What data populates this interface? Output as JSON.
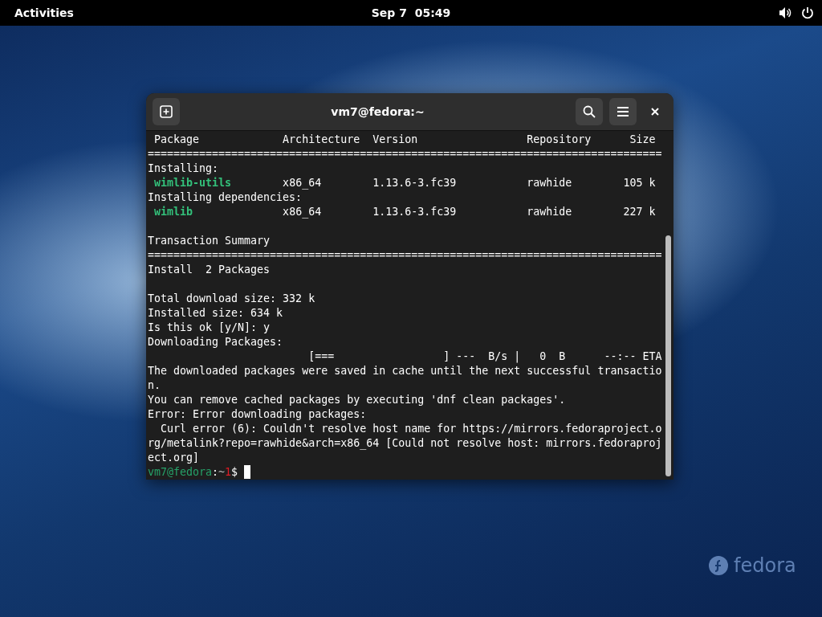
{
  "top_bar": {
    "activities": "Activities",
    "clock": "Sep 7  05:49"
  },
  "terminal": {
    "title": "vm7@fedora:~",
    "lines": [
      {
        "spans": [
          {
            "kind": "plain",
            "text": " Package             Architecture  Version                 Repository      Size"
          }
        ]
      },
      {
        "spans": [
          {
            "kind": "plain",
            "text": "================================================================================"
          }
        ]
      },
      {
        "spans": [
          {
            "kind": "plain",
            "text": "Installing:"
          }
        ]
      },
      {
        "spans": [
          {
            "kind": "package",
            "text": " wimlib-utils"
          },
          {
            "kind": "plain",
            "text": "        x86_64        1.13.6-3.fc39           rawhide        105 k"
          }
        ]
      },
      {
        "spans": [
          {
            "kind": "plain",
            "text": "Installing dependencies:"
          }
        ]
      },
      {
        "spans": [
          {
            "kind": "package",
            "text": " wimlib"
          },
          {
            "kind": "plain",
            "text": "              x86_64        1.13.6-3.fc39           rawhide        227 k"
          }
        ]
      },
      {
        "kind": "blank"
      },
      {
        "spans": [
          {
            "kind": "plain",
            "text": "Transaction Summary"
          }
        ]
      },
      {
        "spans": [
          {
            "kind": "plain",
            "text": "================================================================================"
          }
        ]
      },
      {
        "spans": [
          {
            "kind": "plain",
            "text": "Install  2 Packages"
          }
        ]
      },
      {
        "kind": "blank"
      },
      {
        "spans": [
          {
            "kind": "plain",
            "text": "Total download size: 332 k"
          }
        ]
      },
      {
        "spans": [
          {
            "kind": "plain",
            "text": "Installed size: 634 k"
          }
        ]
      },
      {
        "spans": [
          {
            "kind": "plain",
            "text": "Is this ok [y/N]: y"
          }
        ]
      },
      {
        "spans": [
          {
            "kind": "plain",
            "text": "Downloading Packages:"
          }
        ]
      },
      {
        "spans": [
          {
            "kind": "plain",
            "text": "                         [===                 ] ---  B/s |   0  B      --:-- ETA"
          }
        ]
      },
      {
        "spans": [
          {
            "kind": "plain",
            "text": "The downloaded packages were saved in cache until the next successful transactio"
          }
        ]
      },
      {
        "spans": [
          {
            "kind": "plain",
            "text": "n."
          }
        ]
      },
      {
        "spans": [
          {
            "kind": "plain",
            "text": "You can remove cached packages by executing 'dnf clean packages'."
          }
        ]
      },
      {
        "spans": [
          {
            "kind": "plain",
            "text": "Error: Error downloading packages:"
          }
        ]
      },
      {
        "spans": [
          {
            "kind": "plain",
            "text": "  Curl error (6): Couldn't resolve host name for https://mirrors.fedoraproject.o"
          }
        ]
      },
      {
        "spans": [
          {
            "kind": "plain",
            "text": "rg/metalink?repo=rawhide&arch=x86_64 [Could not resolve host: mirrors.fedoraproj"
          }
        ]
      },
      {
        "spans": [
          {
            "kind": "plain",
            "text": "ect.org]"
          }
        ]
      },
      {
        "spans": [
          {
            "kind": "user",
            "text": "vm7@fedora"
          },
          {
            "kind": "plain",
            "text": ":"
          },
          {
            "kind": "path",
            "text": "~"
          },
          {
            "kind": "status",
            "text": "1"
          },
          {
            "kind": "plain",
            "text": "$ "
          },
          {
            "kind": "cursor"
          }
        ]
      }
    ]
  },
  "logo": {
    "text": "fedora"
  }
}
